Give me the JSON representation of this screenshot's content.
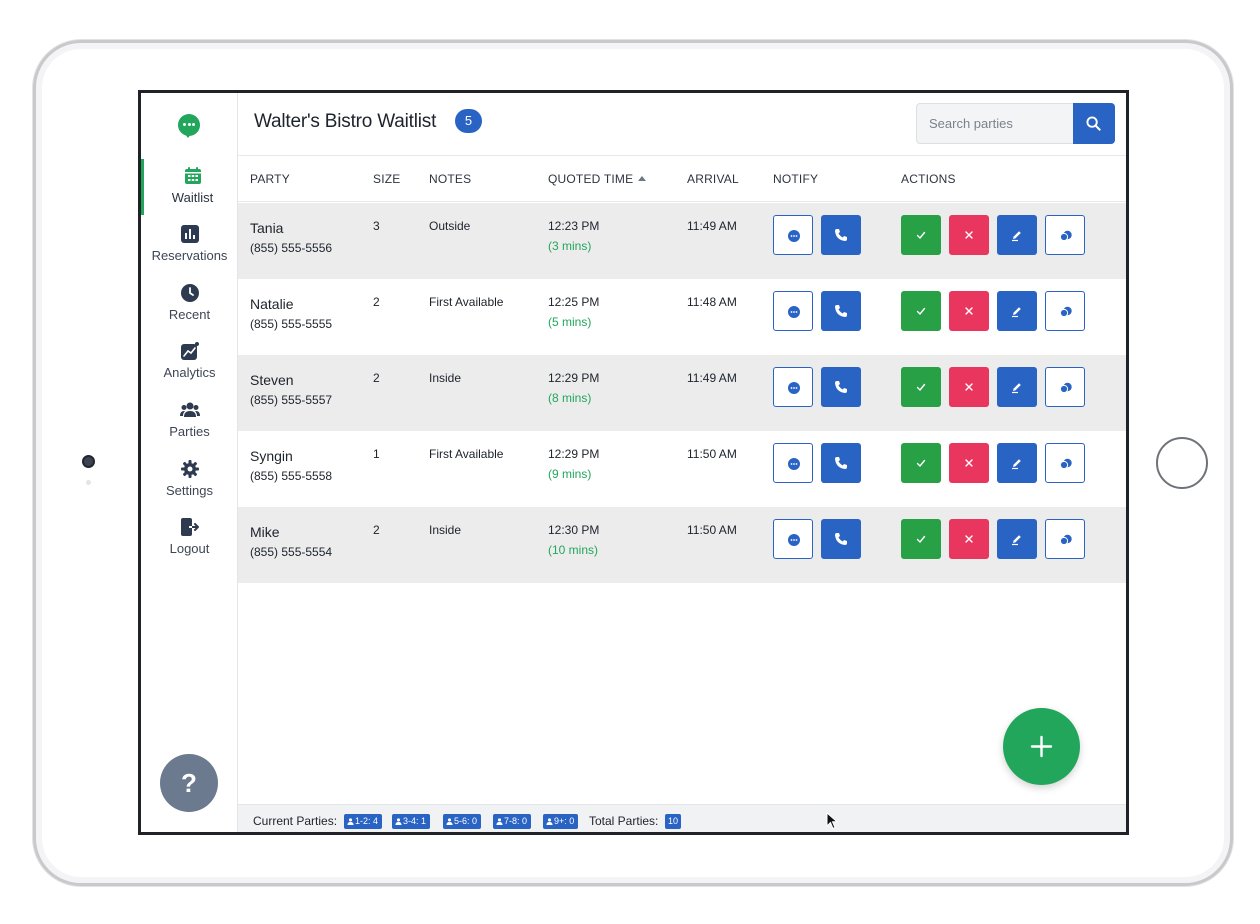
{
  "app": {
    "title": "Walter's Bistro Waitlist",
    "waitlist_count": "5"
  },
  "colors": {
    "brand_green": "#22a65b",
    "primary_blue": "#2963c4",
    "seat_green": "#28a046",
    "remove_red": "#e8365f",
    "sidebar_help": "#6b7a8f"
  },
  "sidebar": {
    "logo_icon": "chat-bubble-icon",
    "items": [
      {
        "label": "Waitlist",
        "icon": "calendar-icon"
      },
      {
        "label": "Reservations",
        "icon": "bar-chart-icon"
      },
      {
        "label": "Recent",
        "icon": "clock-icon"
      },
      {
        "label": "Analytics",
        "icon": "trend-chart-icon"
      },
      {
        "label": "Parties",
        "icon": "users-icon"
      },
      {
        "label": "Settings",
        "icon": "gear-icon"
      },
      {
        "label": "Logout",
        "icon": "logout-icon"
      }
    ],
    "help_label": "?"
  },
  "search": {
    "placeholder": "Search parties"
  },
  "table": {
    "columns": [
      "PARTY",
      "SIZE",
      "NOTES",
      "QUOTED TIME",
      "ARRIVAL",
      "NOTIFY",
      "ACTIONS"
    ],
    "rows": [
      {
        "name": "Tania",
        "phone": "(855) 555-5556",
        "size": "3",
        "notes": "Outside",
        "quoted": "12:23 PM",
        "wait": "(3 mins)",
        "arrival": "11:49 AM"
      },
      {
        "name": "Natalie",
        "phone": "(855) 555-5555",
        "size": "2",
        "notes": "First Available",
        "quoted": "12:25 PM",
        "wait": "(5 mins)",
        "arrival": "11:48 AM"
      },
      {
        "name": "Steven",
        "phone": "(855) 555-5557",
        "size": "2",
        "notes": "Inside",
        "quoted": "12:29 PM",
        "wait": "(8 mins)",
        "arrival": "11:49 AM"
      },
      {
        "name": "Syngin",
        "phone": "(855) 555-5558",
        "size": "1",
        "notes": "First Available",
        "quoted": "12:29 PM",
        "wait": "(9 mins)",
        "arrival": "11:50 AM"
      },
      {
        "name": "Mike",
        "phone": "(855) 555-5554",
        "size": "2",
        "notes": "Inside",
        "quoted": "12:30 PM",
        "wait": "(10 mins)",
        "arrival": "11:50 AM"
      }
    ]
  },
  "footer": {
    "current_label": "Current Parties:",
    "chips": [
      "1-2: 4",
      "3-4: 1",
      "5-6: 0",
      "7-8: 0",
      "9+: 0"
    ],
    "total_label": "Total Parties:",
    "total_value": "10"
  }
}
